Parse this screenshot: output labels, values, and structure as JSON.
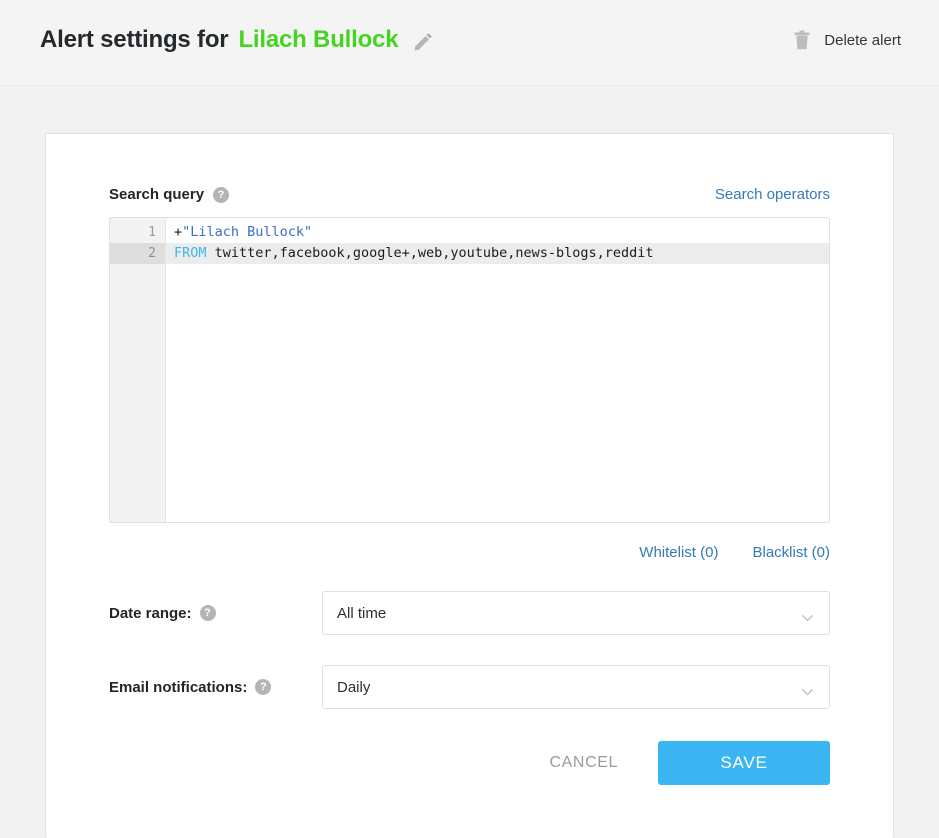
{
  "header": {
    "title_prefix": "Alert settings for",
    "alert_name": "Lilach Bullock",
    "edit_icon": "pencil-icon",
    "delete_label": "Delete alert",
    "delete_icon": "trash-icon",
    "name_color": "#47d321"
  },
  "query_section": {
    "label": "Search query",
    "help_icon": "?",
    "operators_link": "Search operators"
  },
  "editor": {
    "lines": [
      {
        "number": "1",
        "active": false,
        "tokens": [
          {
            "text": "+",
            "type": "plain"
          },
          {
            "text": "\"Lilach Bullock\"",
            "type": "string"
          }
        ]
      },
      {
        "number": "2",
        "active": true,
        "tokens": [
          {
            "text": "FROM",
            "type": "keyword"
          },
          {
            "text": " twitter,facebook,google+,web,youtube,news-blogs,reddit",
            "type": "plain"
          }
        ]
      }
    ],
    "line_numbers": [
      "1",
      "2"
    ],
    "line1_plain": "+",
    "line1_string": "\"Lilach Bullock\"",
    "line2_keyword": "FROM",
    "line2_plain": " twitter,facebook,google+,web,youtube,news-blogs,reddit"
  },
  "lists": {
    "whitelist_label": "Whitelist (0)",
    "whitelist_count": 0,
    "blacklist_label": "Blacklist (0)",
    "blacklist_count": 0
  },
  "form": {
    "date_range": {
      "label": "Date range:",
      "help_icon": "?",
      "value": "All time",
      "chevron_icon": "chevron-down-icon"
    },
    "email_notifications": {
      "label": "Email notifications:",
      "help_icon": "?",
      "value": "Daily",
      "chevron_icon": "chevron-down-icon"
    }
  },
  "actions": {
    "cancel_label": "CANCEL",
    "save_label": "SAVE",
    "save_color": "#3ab5f1"
  }
}
